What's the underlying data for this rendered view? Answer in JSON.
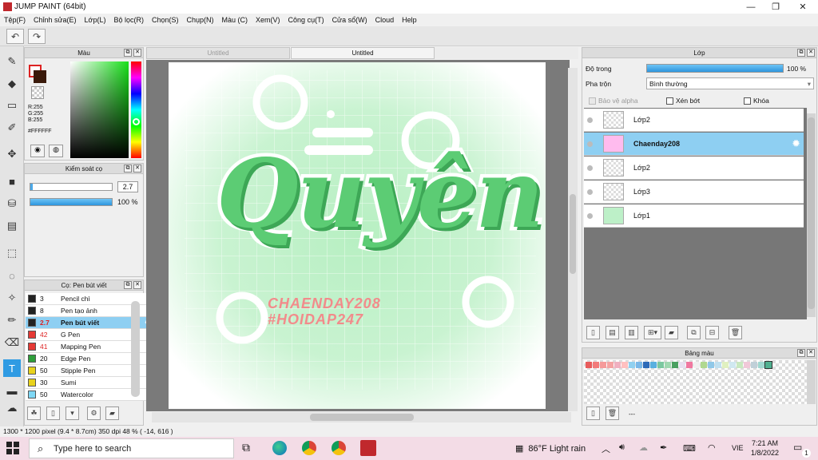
{
  "window": {
    "title": "JUMP PAINT (64bit)"
  },
  "menu": [
    "Tệp(F)",
    "Chỉnh sửa(E)",
    "Lớp(L)",
    "Bộ lọc(R)",
    "Chọn(S)",
    "Chụp(N)",
    "Màu (C)",
    "Xem(V)",
    "Công cụ(T)",
    "Cửa sổ(W)",
    "Cloud",
    "Help"
  ],
  "toolbar": {
    "undo_icon": "undo-icon",
    "redo_icon": "redo-icon"
  },
  "color_panel": {
    "title": "Màu",
    "r": "R:255",
    "g": "G:255",
    "b": "B:255",
    "hex": "#FFFFFF"
  },
  "brush_control": {
    "title": "Kiểm soát cọ",
    "size": "2.7",
    "opacity": "100 %"
  },
  "brush_list": {
    "title": "Cọ: Pen bút viết",
    "items": [
      {
        "size": "3",
        "name": "Pencil chì",
        "color": "#222222"
      },
      {
        "size": "8",
        "name": "Pen tạo ảnh",
        "color": "#222222"
      },
      {
        "size": "2.7",
        "name": "Pen bút viết",
        "color": "#222222"
      },
      {
        "size": "42",
        "name": "G Pen",
        "color": "#e53935"
      },
      {
        "size": "41",
        "name": "Mapping Pen",
        "color": "#e53935"
      },
      {
        "size": "20",
        "name": "Edge Pen",
        "color": "#2e9e3a"
      },
      {
        "size": "50",
        "name": "Stipple Pen",
        "color": "#e8d21c"
      },
      {
        "size": "30",
        "name": "Sumi",
        "color": "#e8d21c"
      },
      {
        "size": "50",
        "name": "Watercolor",
        "color": "#7fd8f5"
      }
    ]
  },
  "tabs": [
    "Untitled",
    "Untitled"
  ],
  "canvas_art": {
    "main_word": "Quyên",
    "credit_1": "CHAENDAY208",
    "credit_2": "#HOIDAP247"
  },
  "layer_panel": {
    "title": "Lớp",
    "opacity_label": "Độ trong",
    "opacity_value": "100 %",
    "blend_label": "Pha trộn",
    "blend_value": "Bình thường",
    "protect_alpha": "Bảo vệ alpha",
    "clipping": "Xén bớt",
    "lock": "Khóa",
    "layers": [
      "Lớp2",
      "Chaenday208",
      "Lớp2",
      "Lớp3",
      "Lớp1"
    ]
  },
  "palette": {
    "title": "Bảng màu",
    "status": "---"
  },
  "statusbar": {
    "text": "1300 * 1200 pixel   (9.4 * 8.7cm)   350 dpi   48 %   ( -14, 616 )"
  },
  "taskbar": {
    "search_placeholder": "Type here to search",
    "weather": "86°F  Light rain",
    "lang": "VIE",
    "time": "7:21 AM",
    "date": "1/8/2022",
    "notif": "1"
  }
}
